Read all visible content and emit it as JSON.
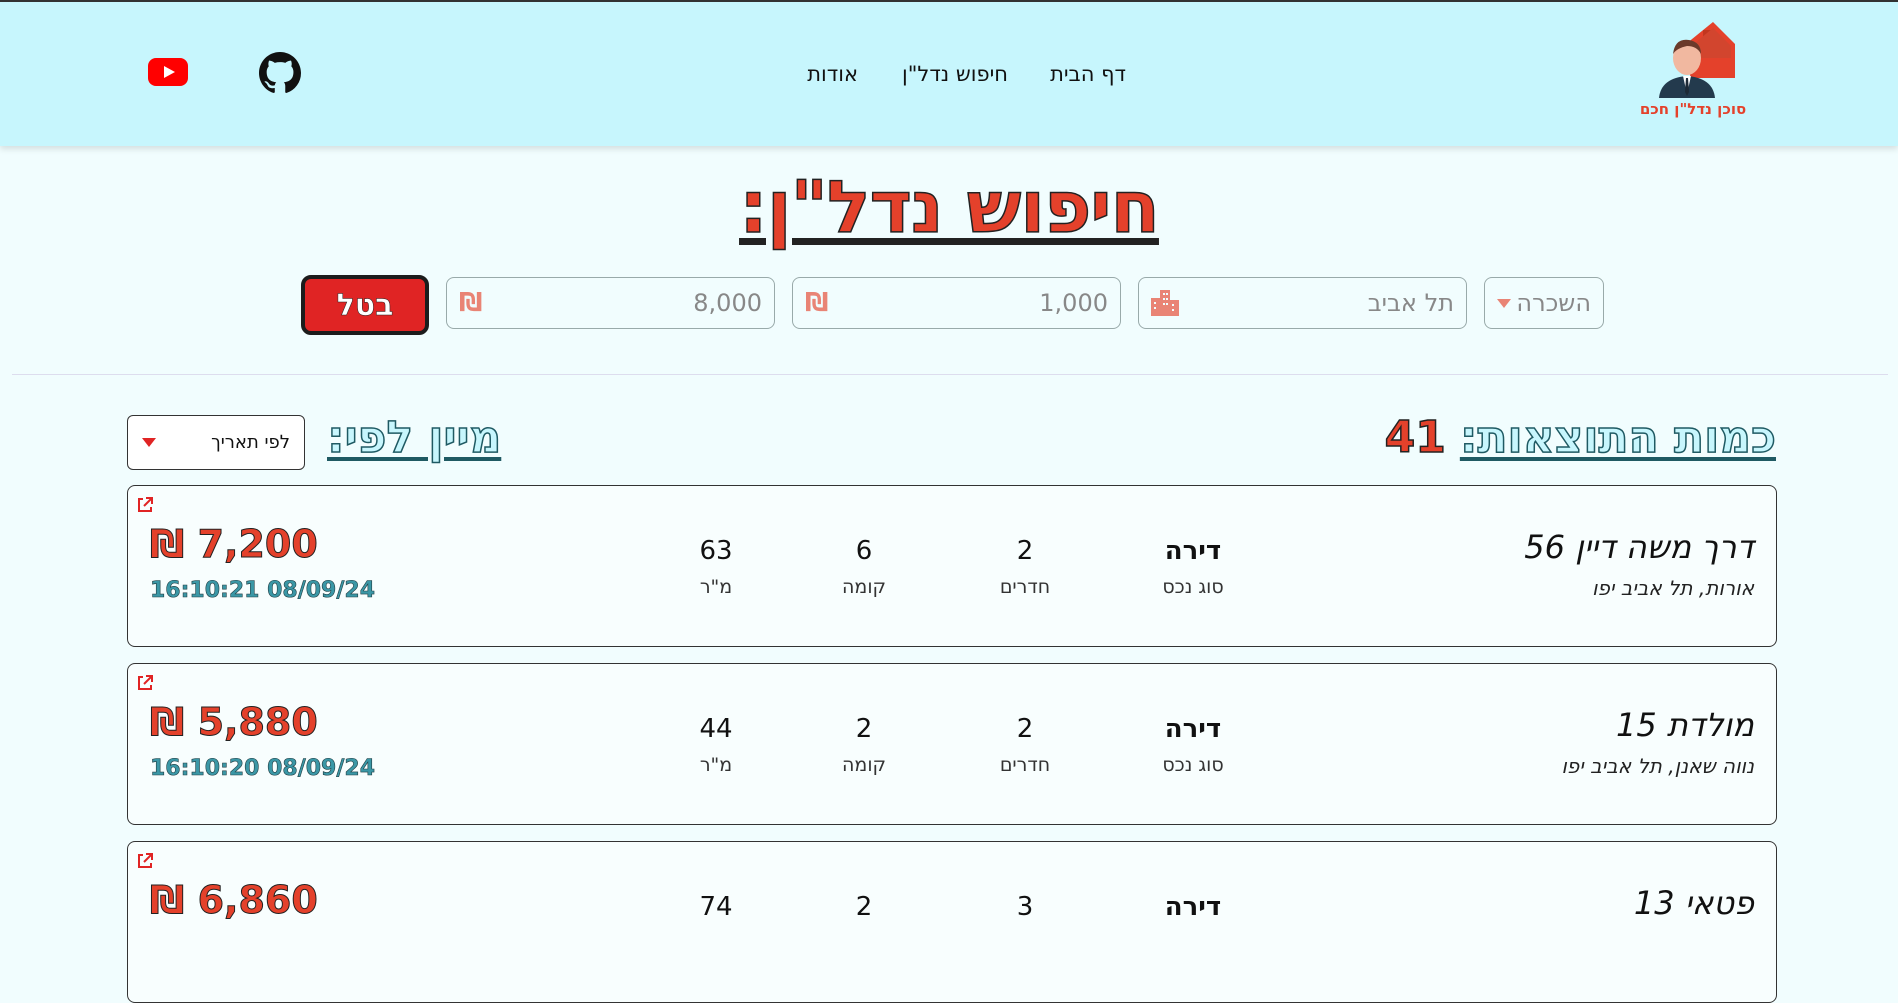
{
  "header": {
    "logo_text": "סוכן נדל\"ן חכם",
    "nav": {
      "home": "דף הבית",
      "search": "חיפוש נדל\"ן",
      "about": "אודות"
    }
  },
  "page_title": "חיפוש נדל\"ן:",
  "filters": {
    "deal_type": "השכרה",
    "city": "תל אביב",
    "min_price": "1,000",
    "max_price": "8,000",
    "currency_icon": "₪",
    "cancel_label": "בטל"
  },
  "results": {
    "label": "כמות התוצאות:",
    "count": "41",
    "sort_label": "מיין לפי:",
    "sort_value": "לפי תאריך"
  },
  "stat_labels": {
    "type": "סוג נכס",
    "rooms": "חדרים",
    "floor": "קומה",
    "sqm": "מ\"ר"
  },
  "listings": [
    {
      "street": "דרך משה דיין 56",
      "neighborhood": "אורות, תל אביב יפו",
      "type": "דירה",
      "rooms": "2",
      "floor": "6",
      "sqm": "63",
      "price": "₪ 7,200",
      "date": "16:10:21 08/09/24"
    },
    {
      "street": "מולדת 15",
      "neighborhood": "נווה שאנן, תל אביב יפו",
      "type": "דירה",
      "rooms": "2",
      "floor": "2",
      "sqm": "44",
      "price": "₪ 5,880",
      "date": "16:10:20 08/09/24"
    },
    {
      "street": "פטאי 13",
      "neighborhood": "",
      "type": "דירה",
      "rooms": "3",
      "floor": "2",
      "sqm": "74",
      "price": "₪ 6,860",
      "date": ""
    }
  ],
  "colors": {
    "header_bg": "#c7f6fd",
    "accent": "#e4412b",
    "cancel": "#e02424",
    "page_bg": "#f1fdfe"
  }
}
